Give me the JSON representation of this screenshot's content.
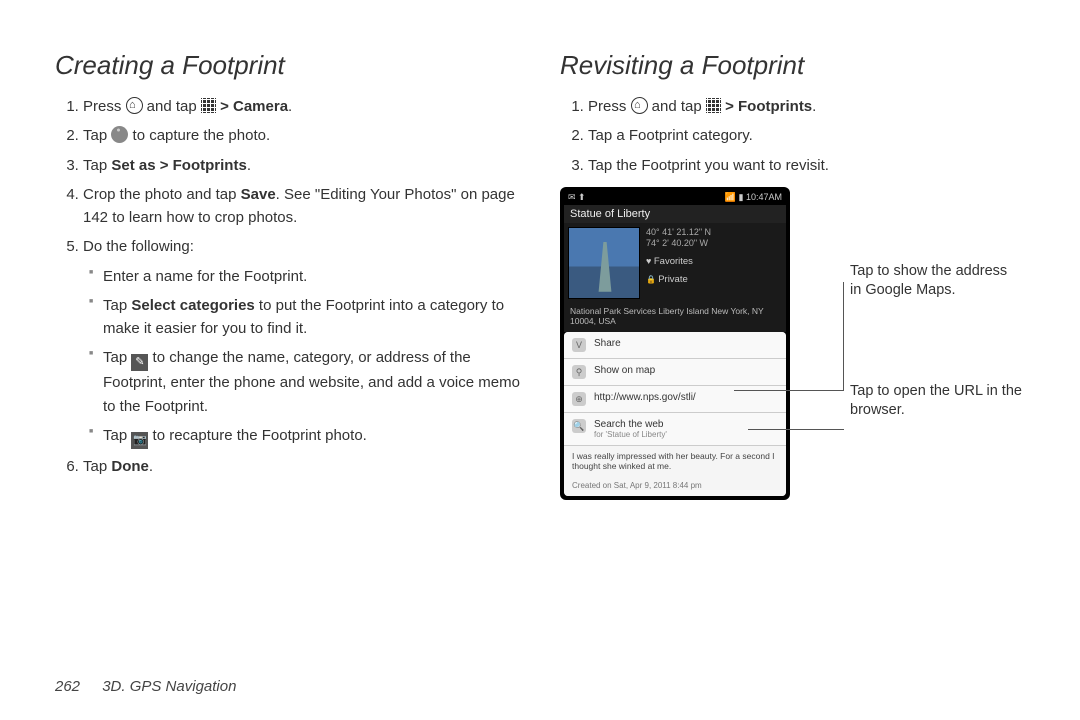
{
  "left": {
    "heading": "Creating a Footprint",
    "steps": {
      "s1_a": "Press ",
      "s1_b": " and tap ",
      "s1_c": " > Camera",
      "s1_d": ".",
      "s2_a": "Tap ",
      "s2_b": " to capture the photo.",
      "s3_a": "Tap ",
      "s3_b": "Set as > Footprints",
      "s3_c": ".",
      "s4_a": "Crop the photo and tap ",
      "s4_b": "Save",
      "s4_c": ". See  \"Editing Your Photos\" on page 142 to learn how to crop photos.",
      "s5": "Do the following:",
      "s5_1": "Enter a name for the Footprint.",
      "s5_2a": "Tap ",
      "s5_2b": "Select categories",
      "s5_2c": " to put the Footprint into a category to make it easier for you to find it.",
      "s5_3a": "Tap ",
      "s5_3b": " to change the name, category, or address of the Footprint, enter the phone and website, and add a voice memo to the Footprint.",
      "s5_4a": "Tap ",
      "s5_4b": " to recapture the Footprint photo.",
      "s6_a": "Tap ",
      "s6_b": "Done",
      "s6_c": "."
    }
  },
  "right": {
    "heading": "Revisiting a Footprint",
    "steps": {
      "s1_a": "Press ",
      "s1_b": " and tap ",
      "s1_c": " > Footprints",
      "s1_d": ".",
      "s2": "Tap a Footprint category.",
      "s3": "Tap the Footprint you want to revisit."
    },
    "callout1": "Tap to show the address in Google Maps.",
    "callout2": "Tap to open the URL in the browser."
  },
  "phone": {
    "status_left": "✉ ⬆",
    "status_right": "📶 ▮ 10:47AM",
    "title": "Statue of Liberty",
    "coord1": "40° 41' 21.12\" N",
    "coord2": "74° 2' 40.20\" W",
    "fav": "Favorites",
    "priv": "Private",
    "address": "National Park Services Liberty Island New York, NY 10004, USA",
    "share": "Share",
    "showmap": "Show on map",
    "url": "http://www.nps.gov/stli/",
    "search": "Search the web",
    "search_sub": "for 'Statue of Liberty'",
    "memo": "I was really impressed with her beauty. For a second I thought she winked at me.",
    "created": "Created on Sat, Apr 9, 2011 8:44 pm"
  },
  "footer": {
    "page": "262",
    "section": "3D. GPS Navigation"
  }
}
